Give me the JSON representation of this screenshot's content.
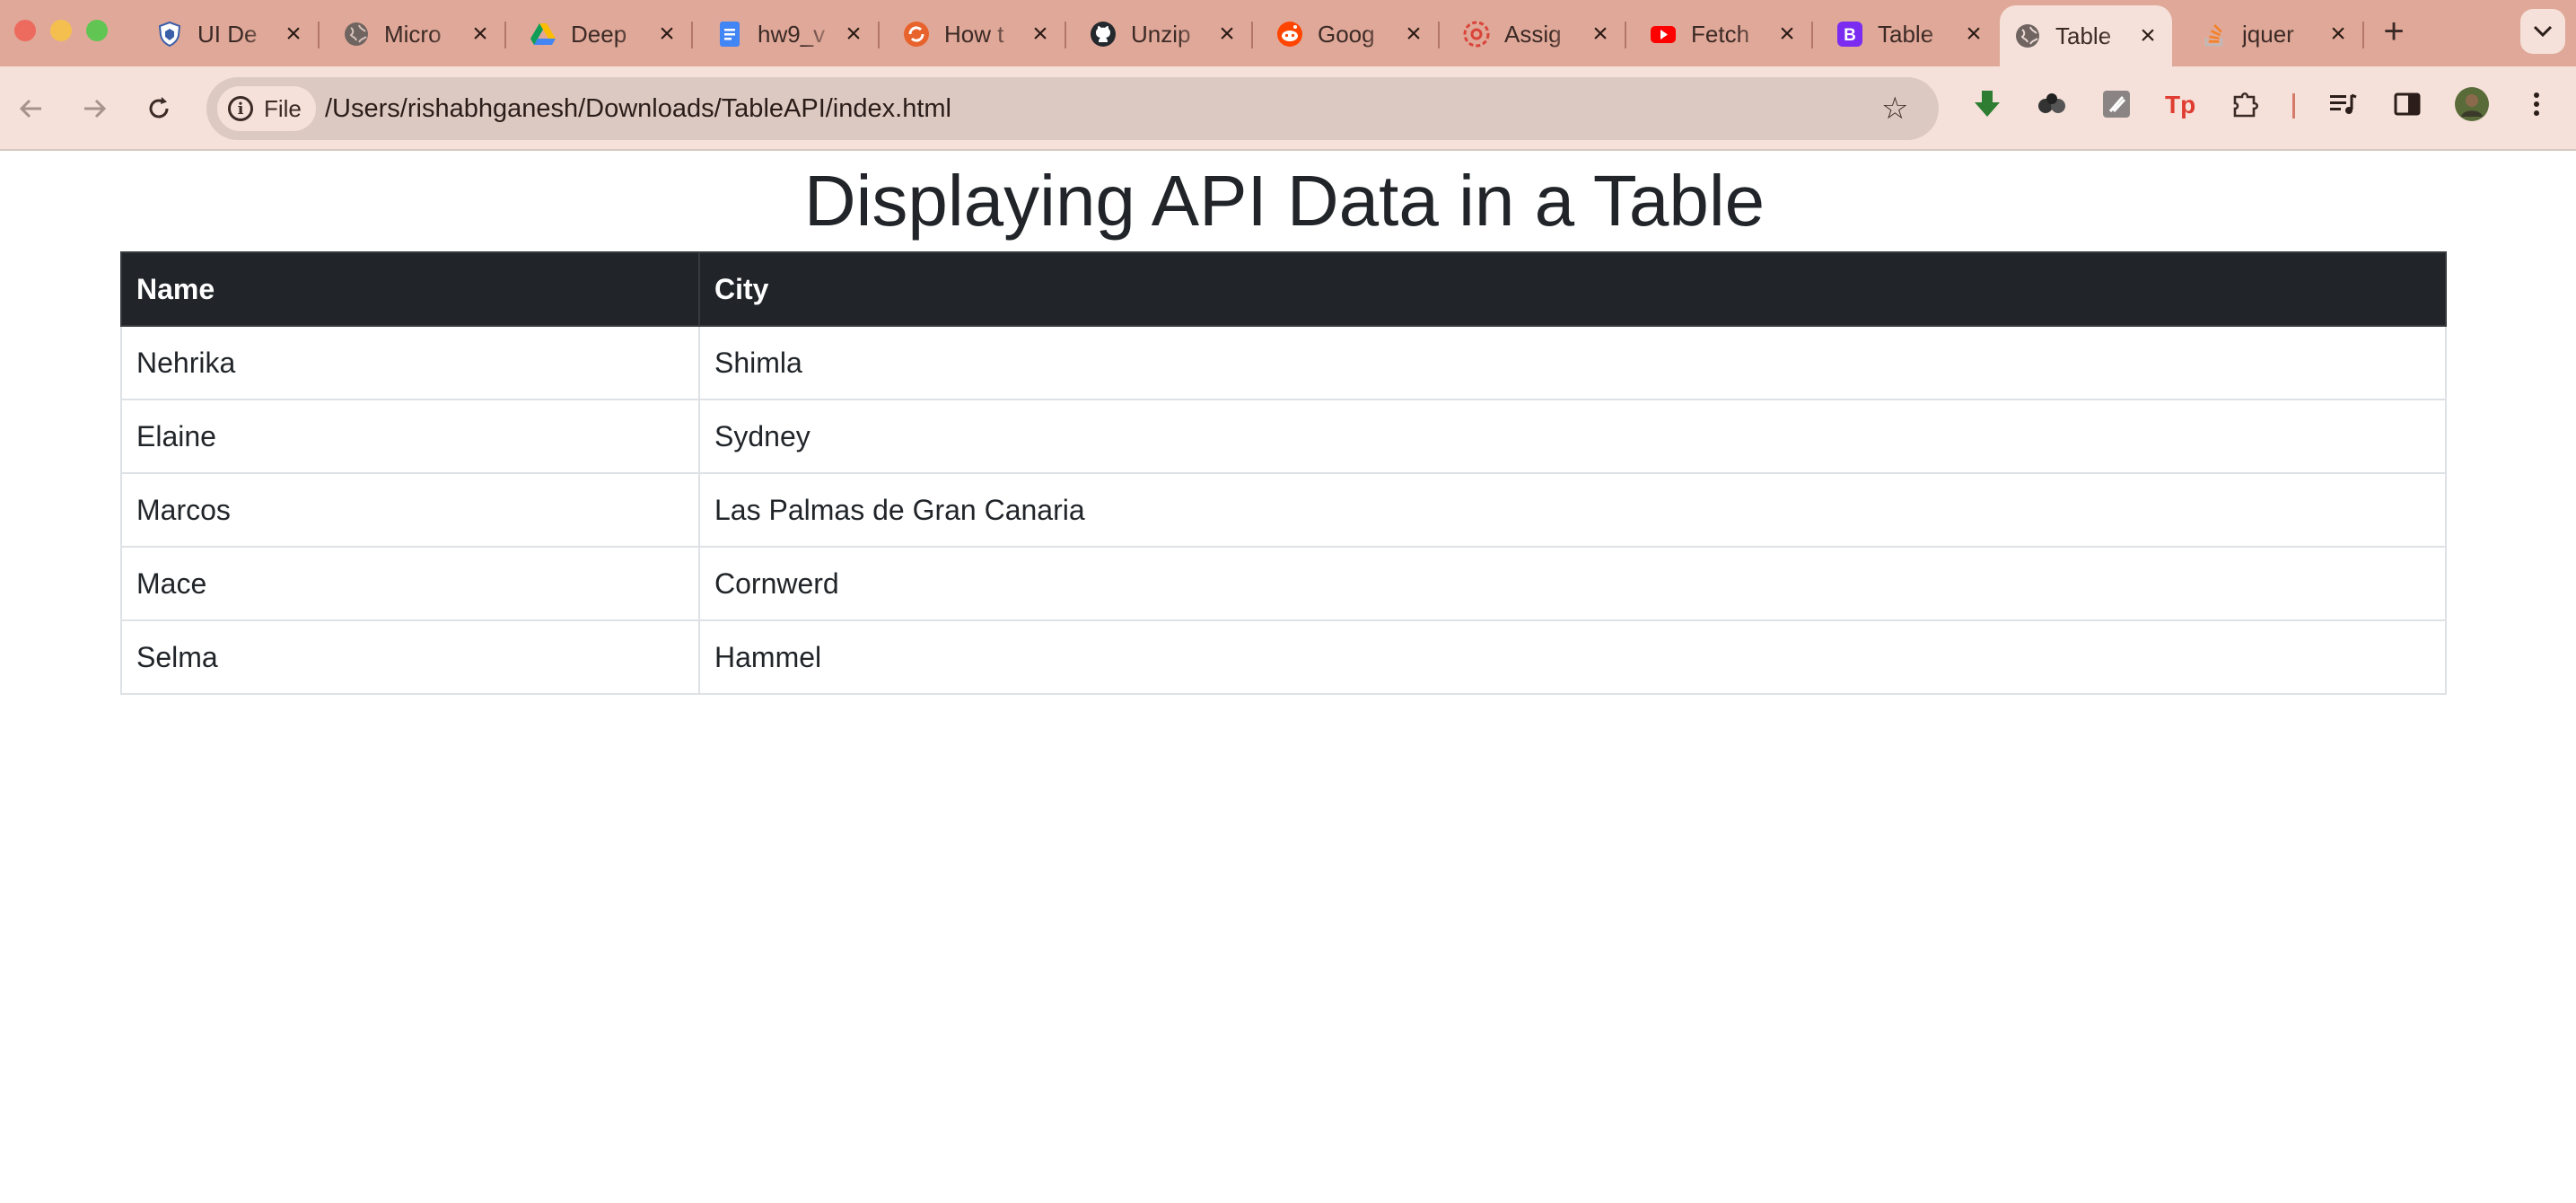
{
  "browser": {
    "tabs": [
      {
        "title": "UI De",
        "icon": "shield-icon",
        "active": false
      },
      {
        "title": "Micro",
        "icon": "globe-icon",
        "active": false
      },
      {
        "title": "Deep",
        "icon": "drive-icon",
        "active": false
      },
      {
        "title": "hw9_v",
        "icon": "docs-icon",
        "active": false
      },
      {
        "title": "How t",
        "icon": "sync-icon",
        "active": false
      },
      {
        "title": "Unzip",
        "icon": "github-icon",
        "active": false
      },
      {
        "title": "Goog",
        "icon": "reddit-icon",
        "active": false
      },
      {
        "title": "Assig",
        "icon": "canvas-icon",
        "active": false
      },
      {
        "title": "Fetch",
        "icon": "youtube-icon",
        "active": false
      },
      {
        "title": "Table",
        "icon": "bootstrap-icon",
        "active": false
      },
      {
        "title": "Table",
        "icon": "globe-icon",
        "active": true
      },
      {
        "title": "jquer",
        "icon": "stackoverflow-icon",
        "active": false
      }
    ],
    "address_bar": {
      "chip_label": "File",
      "url": "/Users/rishabhganesh/Downloads/TableAPI/index.html"
    },
    "colors": {
      "tabstrip": "#e0a898",
      "toolbar": "#f5e1d9",
      "omnibox": "#dcc9c2"
    }
  },
  "page": {
    "heading": "Displaying API Data in a Table",
    "table": {
      "headers": [
        "Name",
        "City"
      ],
      "rows": [
        [
          "Nehrika",
          "Shimla"
        ],
        [
          "Elaine",
          "Sydney"
        ],
        [
          "Marcos",
          "Las Palmas de Gran Canaria"
        ],
        [
          "Mace",
          "Cornwerd"
        ],
        [
          "Selma",
          "Hammel"
        ]
      ]
    },
    "colors": {
      "header_bg": "#212529",
      "header_text": "#ffffff",
      "border": "#dee2e6",
      "text": "#212529"
    }
  }
}
